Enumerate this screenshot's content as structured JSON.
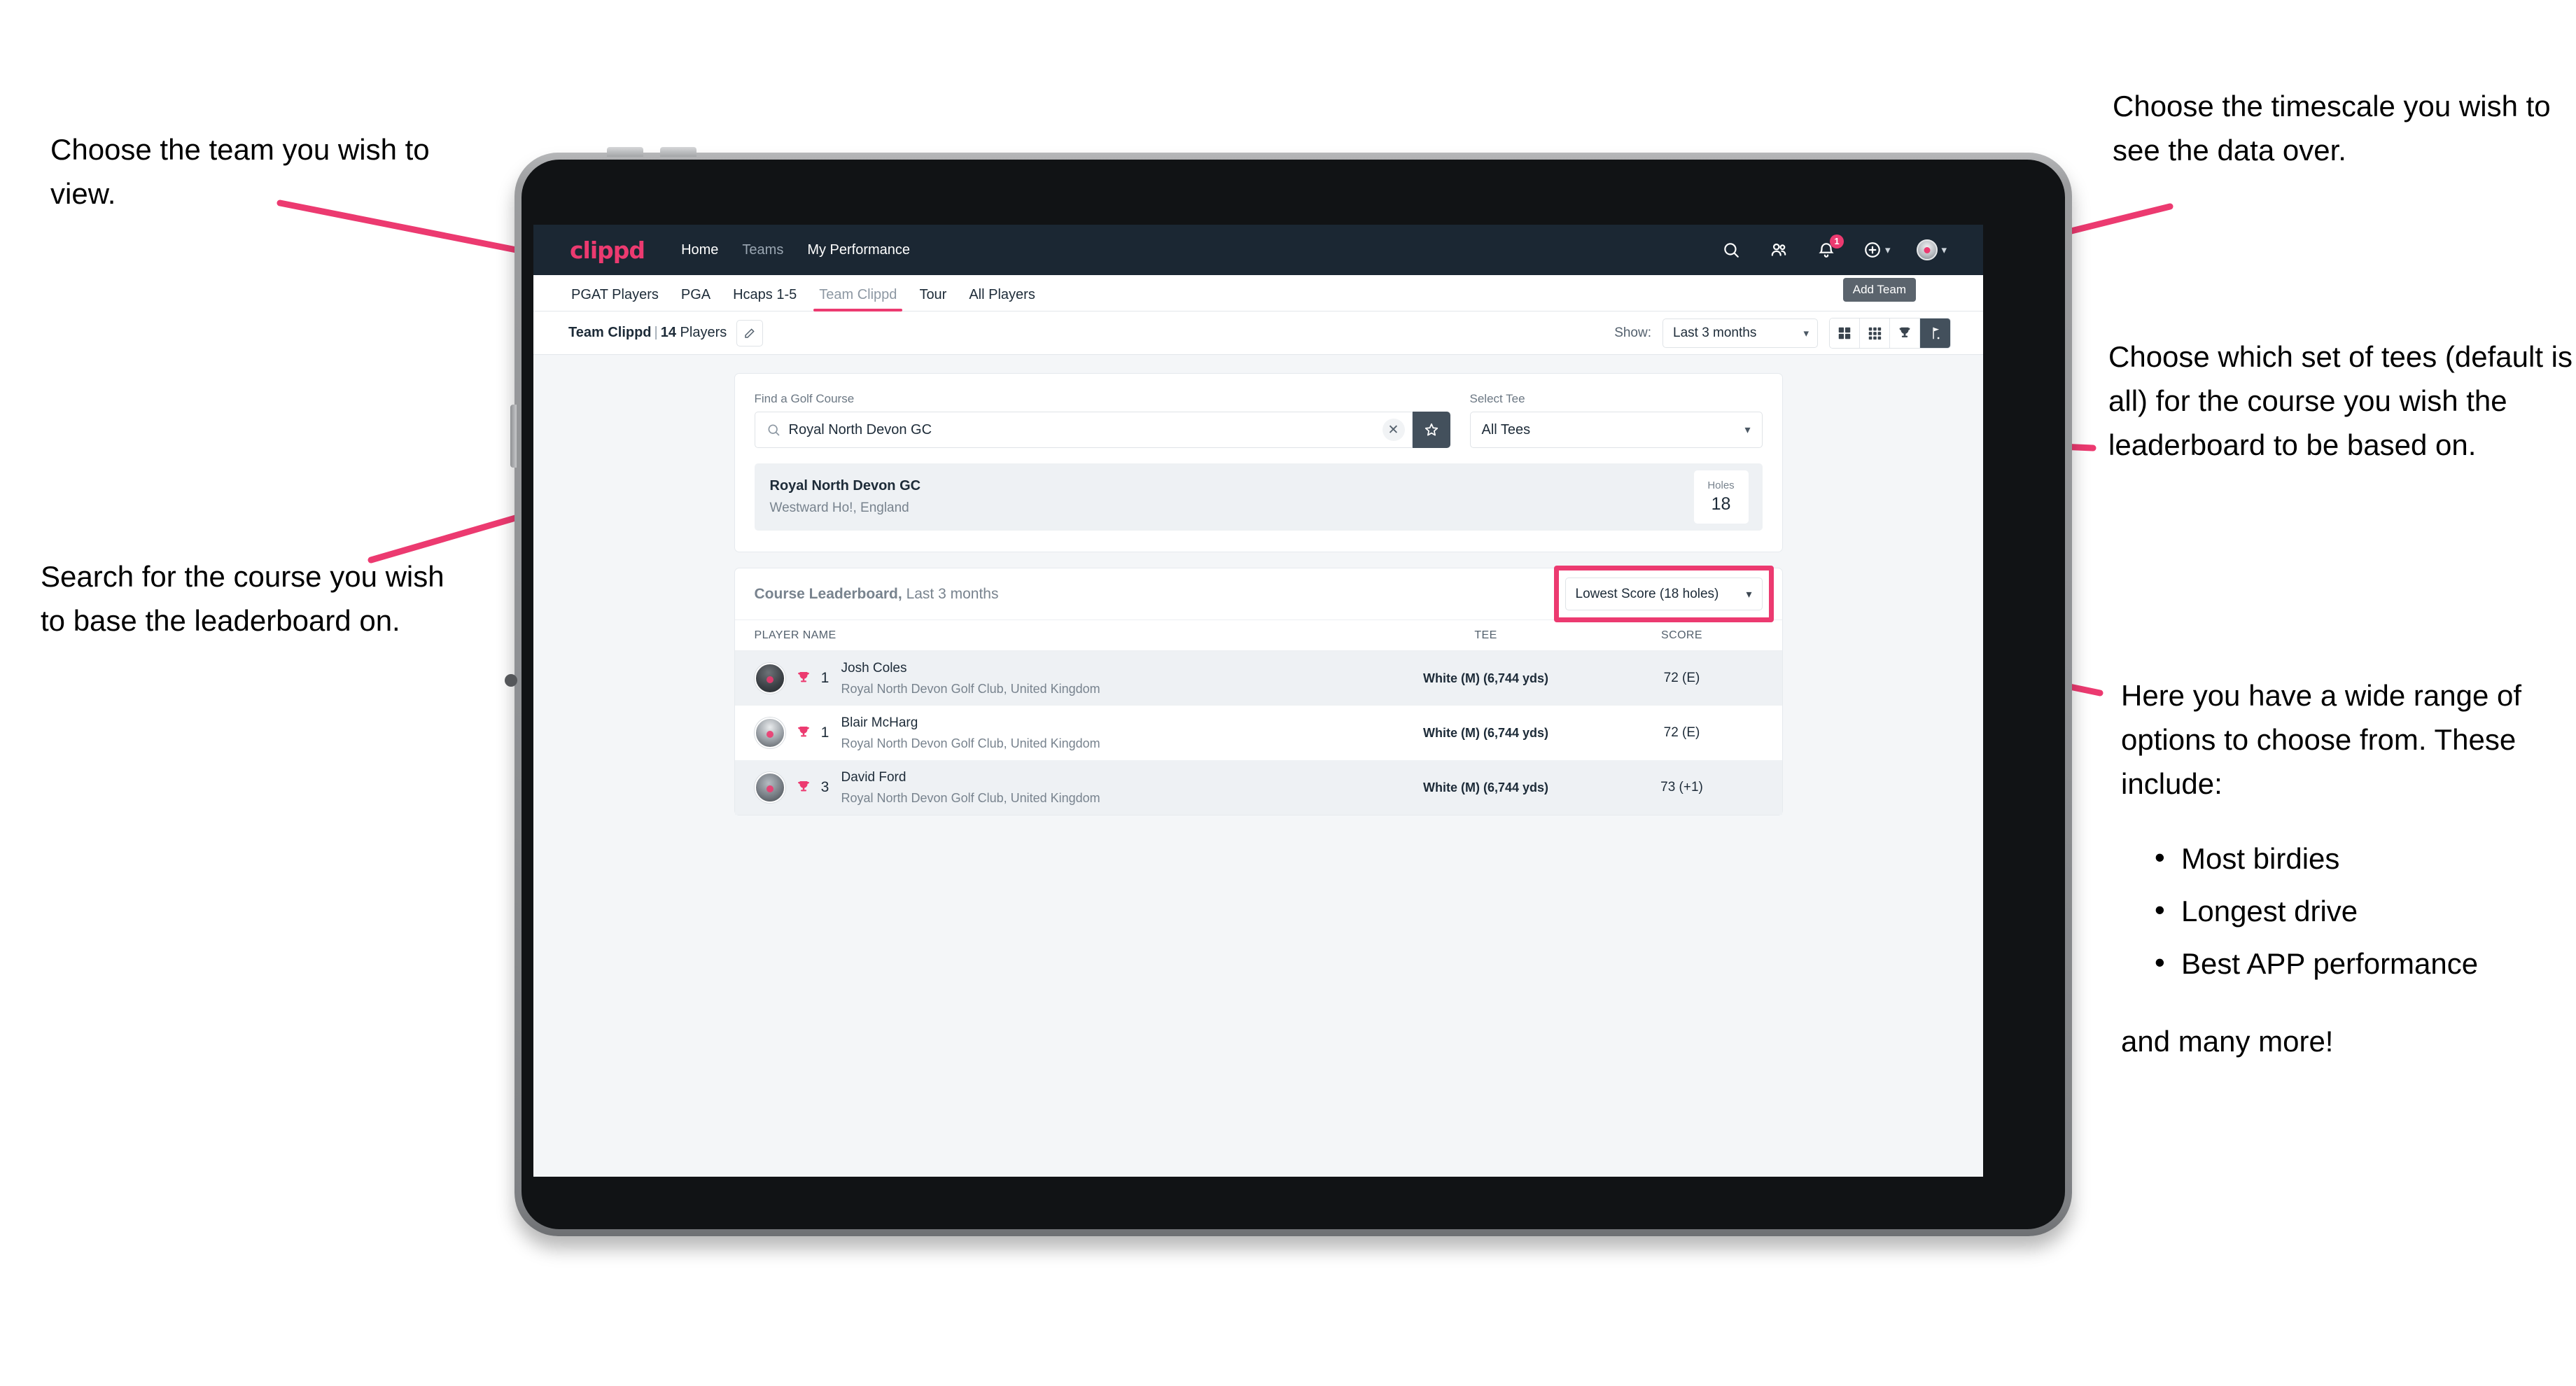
{
  "annotations": {
    "team": "Choose the team you wish to view.",
    "search": "Search for the course you wish to base the leaderboard on.",
    "timescale": "Choose the timescale you wish to see the data over.",
    "tees": "Choose which set of tees (default is all) for the course you wish the leaderboard to be based on.",
    "options_intro": "Here you have a wide range of options to choose from. These include:",
    "options_list": [
      "Most birdies",
      "Longest drive",
      "Best APP performance"
    ],
    "options_tail": "and many more!"
  },
  "colors": {
    "accent": "#ec3a70",
    "navbar": "#1b2733",
    "dark_button": "#43505c",
    "page_bg": "#f4f6f8"
  },
  "navbar": {
    "brand": "clippd",
    "links": [
      {
        "label": "Home",
        "dim": false
      },
      {
        "label": "Teams",
        "dim": true
      },
      {
        "label": "My Performance",
        "dim": false
      }
    ],
    "icons": [
      "search-icon",
      "people-icon",
      "bell-icon",
      "plus-circle-icon",
      "avatar"
    ],
    "notification_count": "1"
  },
  "subnav": {
    "items": [
      {
        "label": "PGAT Players",
        "active": false
      },
      {
        "label": "PGA",
        "active": false
      },
      {
        "label": "Hcaps 1-5",
        "active": false
      },
      {
        "label": "Team Clippd",
        "active": true
      },
      {
        "label": "Tour",
        "active": false
      },
      {
        "label": "All Players",
        "active": false
      }
    ]
  },
  "tooltip": {
    "text": "Add Team"
  },
  "toolbar": {
    "team_name": "Team Clippd",
    "separator": "|",
    "player_count": "14",
    "players_word": "Players",
    "edit_icon": "pencil-icon",
    "show_label": "Show:",
    "period_value": "Last 3 months",
    "views": [
      {
        "name": "grid-4-view",
        "active": false
      },
      {
        "name": "grid-9-view",
        "active": false
      },
      {
        "name": "trophy-view",
        "active": false
      },
      {
        "name": "flag-view",
        "active": true
      }
    ]
  },
  "search": {
    "course_label": "Find a Golf Course",
    "course_value": "Royal North Devon GC",
    "course_placeholder": "Find a Golf Course",
    "clear_icon": "close-icon",
    "favourite_icon": "star-icon",
    "tee_label": "Select Tee",
    "tee_value": "All Tees"
  },
  "course_card": {
    "name": "Royal North Devon GC",
    "location": "Westward Ho!, England",
    "holes_label": "Holes",
    "holes_value": "18"
  },
  "leaderboard": {
    "title": "Course Leaderboard,",
    "subtitle": " Last 3 months",
    "metric_value": "Lowest Score (18 holes)",
    "columns": {
      "player": "PLAYER NAME",
      "tee": "TEE",
      "score": "SCORE"
    },
    "rows": [
      {
        "rank": "1",
        "name": "Josh Coles",
        "club": "Royal North Devon Golf Club, United Kingdom",
        "tee": "White (M) (6,744 yds)",
        "score": "72 (E)"
      },
      {
        "rank": "1",
        "name": "Blair McHarg",
        "club": "Royal North Devon Golf Club, United Kingdom",
        "tee": "White (M) (6,744 yds)",
        "score": "72 (E)"
      },
      {
        "rank": "3",
        "name": "David Ford",
        "club": "Royal North Devon Golf Club, United Kingdom",
        "tee": "White (M) (6,744 yds)",
        "score": "73 (+1)"
      }
    ]
  }
}
